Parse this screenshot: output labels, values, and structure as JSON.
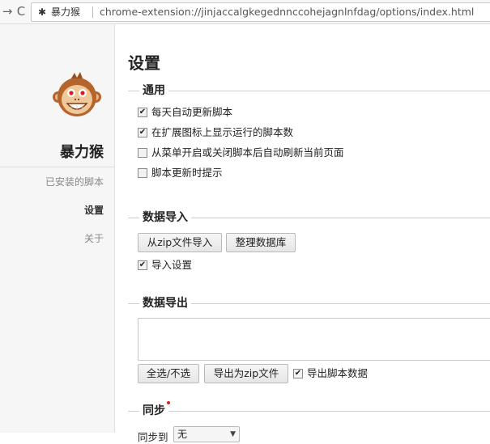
{
  "browser": {
    "forward_glyph": "→",
    "reload_glyph": "C",
    "extension_icon": "puzzle-icon",
    "tab_title": "暴力猴",
    "url": "chrome-extension://jinjaccalgkegednnccohejagnlnfdag/options/index.html"
  },
  "sidebar": {
    "logo_icon": "monkey-logo",
    "brand": "暴力猴",
    "items": [
      {
        "label": "已安装的脚本"
      },
      {
        "label": "设置"
      },
      {
        "label": "关于"
      }
    ]
  },
  "main": {
    "title": "设置",
    "general": {
      "heading": "通用",
      "options": [
        {
          "label": "每天自动更新脚本",
          "checked": true
        },
        {
          "label": "在扩展图标上显示运行的脚本数",
          "checked": true
        },
        {
          "label": "从菜单开启或关闭脚本后自动刷新当前页面",
          "checked": false
        },
        {
          "label": "脚本更新时提示",
          "checked": false
        }
      ]
    },
    "import": {
      "heading": "数据导入",
      "btn_import_zip": "从zip文件导入",
      "btn_vacuum": "整理数据库",
      "option_import_settings": {
        "label": "导入设置",
        "checked": true
      }
    },
    "export": {
      "heading": "数据导出",
      "btn_select_all": "全选/不选",
      "btn_export_zip": "导出为zip文件",
      "option_export_values": {
        "label": "导出脚本数据",
        "checked": true
      }
    },
    "sync": {
      "heading": "同步",
      "label": "同步到",
      "select_value": "无"
    }
  },
  "colors": {
    "sidebar_bg": "#f6f6f6",
    "accent_red": "#e02020"
  }
}
